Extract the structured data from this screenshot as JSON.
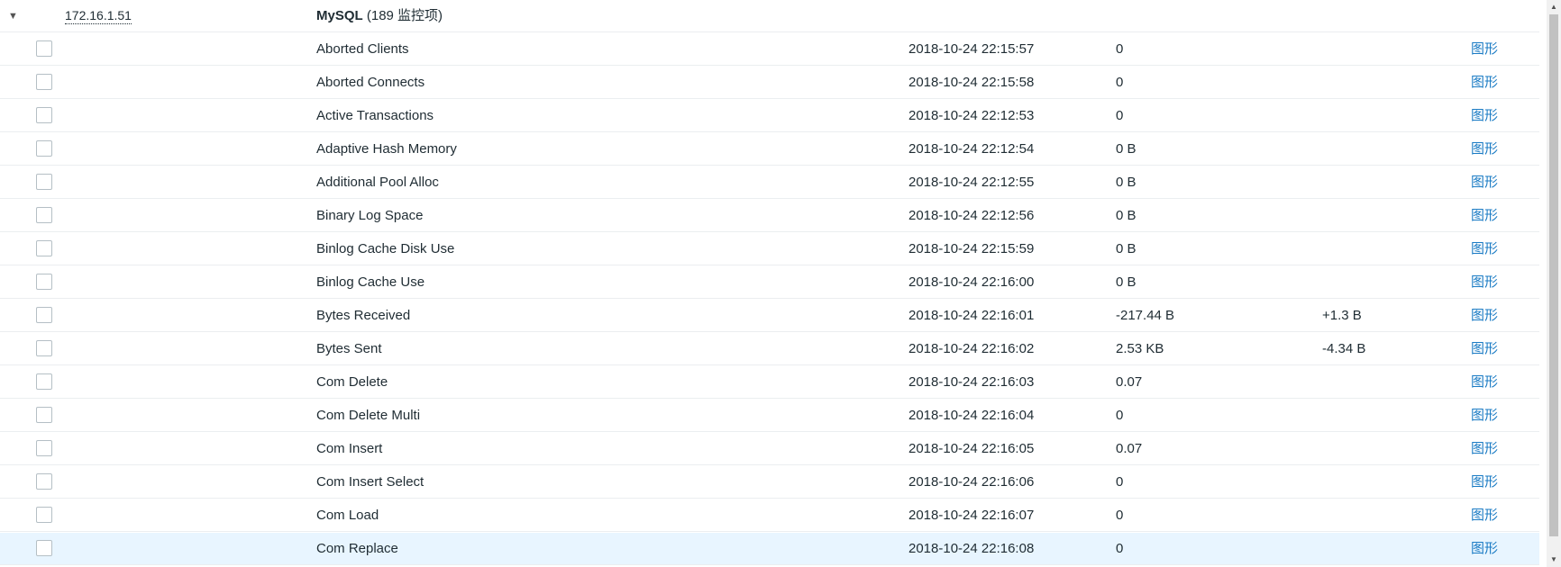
{
  "group": {
    "toggle_glyph": "▼",
    "host": "172.16.1.51",
    "app_name": "MySQL",
    "app_count": "(189 监控项)"
  },
  "graph_label": "图形",
  "rows": [
    {
      "name": "Aborted Clients",
      "time": "2018-10-24 22:15:57",
      "value": "0",
      "change": ""
    },
    {
      "name": "Aborted Connects",
      "time": "2018-10-24 22:15:58",
      "value": "0",
      "change": ""
    },
    {
      "name": "Active Transactions",
      "time": "2018-10-24 22:12:53",
      "value": "0",
      "change": ""
    },
    {
      "name": "Adaptive Hash Memory",
      "time": "2018-10-24 22:12:54",
      "value": "0 B",
      "change": ""
    },
    {
      "name": "Additional Pool Alloc",
      "time": "2018-10-24 22:12:55",
      "value": "0 B",
      "change": ""
    },
    {
      "name": "Binary Log Space",
      "time": "2018-10-24 22:12:56",
      "value": "0 B",
      "change": ""
    },
    {
      "name": "Binlog Cache Disk Use",
      "time": "2018-10-24 22:15:59",
      "value": "0 B",
      "change": ""
    },
    {
      "name": "Binlog Cache Use",
      "time": "2018-10-24 22:16:00",
      "value": "0 B",
      "change": ""
    },
    {
      "name": "Bytes Received",
      "time": "2018-10-24 22:16:01",
      "value": "-217.44 B",
      "change": "+1.3 B"
    },
    {
      "name": "Bytes Sent",
      "time": "2018-10-24 22:16:02",
      "value": "2.53 KB",
      "change": "-4.34 B"
    },
    {
      "name": "Com Delete",
      "time": "2018-10-24 22:16:03",
      "value": "0.07",
      "change": ""
    },
    {
      "name": "Com Delete Multi",
      "time": "2018-10-24 22:16:04",
      "value": "0",
      "change": ""
    },
    {
      "name": "Com Insert",
      "time": "2018-10-24 22:16:05",
      "value": "0.07",
      "change": ""
    },
    {
      "name": "Com Insert Select",
      "time": "2018-10-24 22:16:06",
      "value": "0",
      "change": ""
    },
    {
      "name": "Com Load",
      "time": "2018-10-24 22:16:07",
      "value": "0",
      "change": ""
    },
    {
      "name": "Com Replace",
      "time": "2018-10-24 22:16:08",
      "value": "0",
      "change": "",
      "highlighted": true
    }
  ],
  "scrollbar": {
    "up_glyph": "▲",
    "down_glyph": "▼"
  }
}
